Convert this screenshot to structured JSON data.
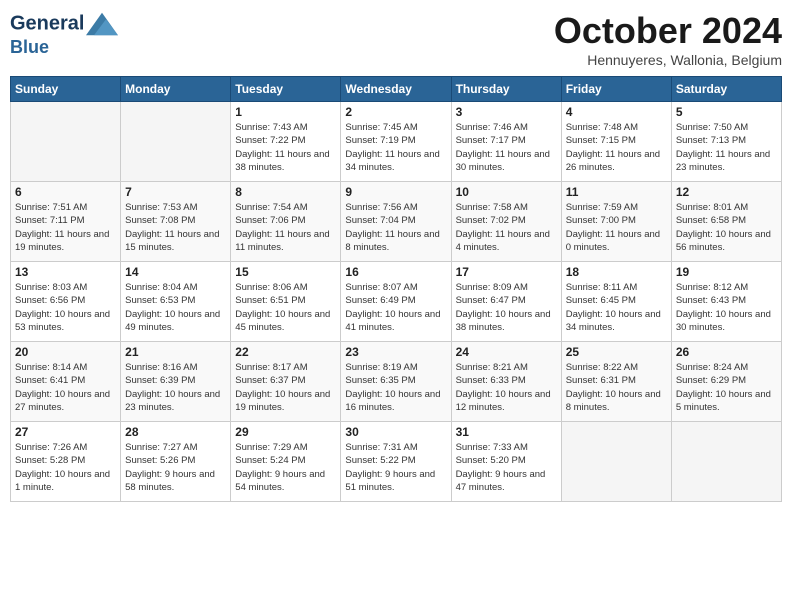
{
  "header": {
    "logo_line1": "General",
    "logo_line2": "Blue",
    "month_title": "October 2024",
    "location": "Hennuyeres, Wallonia, Belgium"
  },
  "days_of_week": [
    "Sunday",
    "Monday",
    "Tuesday",
    "Wednesday",
    "Thursday",
    "Friday",
    "Saturday"
  ],
  "weeks": [
    [
      {
        "day": "",
        "empty": true
      },
      {
        "day": "",
        "empty": true
      },
      {
        "day": "1",
        "sunrise": "7:43 AM",
        "sunset": "7:22 PM",
        "daylight": "11 hours and 38 minutes."
      },
      {
        "day": "2",
        "sunrise": "7:45 AM",
        "sunset": "7:19 PM",
        "daylight": "11 hours and 34 minutes."
      },
      {
        "day": "3",
        "sunrise": "7:46 AM",
        "sunset": "7:17 PM",
        "daylight": "11 hours and 30 minutes."
      },
      {
        "day": "4",
        "sunrise": "7:48 AM",
        "sunset": "7:15 PM",
        "daylight": "11 hours and 26 minutes."
      },
      {
        "day": "5",
        "sunrise": "7:50 AM",
        "sunset": "7:13 PM",
        "daylight": "11 hours and 23 minutes."
      }
    ],
    [
      {
        "day": "6",
        "sunrise": "7:51 AM",
        "sunset": "7:11 PM",
        "daylight": "11 hours and 19 minutes."
      },
      {
        "day": "7",
        "sunrise": "7:53 AM",
        "sunset": "7:08 PM",
        "daylight": "11 hours and 15 minutes."
      },
      {
        "day": "8",
        "sunrise": "7:54 AM",
        "sunset": "7:06 PM",
        "daylight": "11 hours and 11 minutes."
      },
      {
        "day": "9",
        "sunrise": "7:56 AM",
        "sunset": "7:04 PM",
        "daylight": "11 hours and 8 minutes."
      },
      {
        "day": "10",
        "sunrise": "7:58 AM",
        "sunset": "7:02 PM",
        "daylight": "11 hours and 4 minutes."
      },
      {
        "day": "11",
        "sunrise": "7:59 AM",
        "sunset": "7:00 PM",
        "daylight": "11 hours and 0 minutes."
      },
      {
        "day": "12",
        "sunrise": "8:01 AM",
        "sunset": "6:58 PM",
        "daylight": "10 hours and 56 minutes."
      }
    ],
    [
      {
        "day": "13",
        "sunrise": "8:03 AM",
        "sunset": "6:56 PM",
        "daylight": "10 hours and 53 minutes."
      },
      {
        "day": "14",
        "sunrise": "8:04 AM",
        "sunset": "6:53 PM",
        "daylight": "10 hours and 49 minutes."
      },
      {
        "day": "15",
        "sunrise": "8:06 AM",
        "sunset": "6:51 PM",
        "daylight": "10 hours and 45 minutes."
      },
      {
        "day": "16",
        "sunrise": "8:07 AM",
        "sunset": "6:49 PM",
        "daylight": "10 hours and 41 minutes."
      },
      {
        "day": "17",
        "sunrise": "8:09 AM",
        "sunset": "6:47 PM",
        "daylight": "10 hours and 38 minutes."
      },
      {
        "day": "18",
        "sunrise": "8:11 AM",
        "sunset": "6:45 PM",
        "daylight": "10 hours and 34 minutes."
      },
      {
        "day": "19",
        "sunrise": "8:12 AM",
        "sunset": "6:43 PM",
        "daylight": "10 hours and 30 minutes."
      }
    ],
    [
      {
        "day": "20",
        "sunrise": "8:14 AM",
        "sunset": "6:41 PM",
        "daylight": "10 hours and 27 minutes."
      },
      {
        "day": "21",
        "sunrise": "8:16 AM",
        "sunset": "6:39 PM",
        "daylight": "10 hours and 23 minutes."
      },
      {
        "day": "22",
        "sunrise": "8:17 AM",
        "sunset": "6:37 PM",
        "daylight": "10 hours and 19 minutes."
      },
      {
        "day": "23",
        "sunrise": "8:19 AM",
        "sunset": "6:35 PM",
        "daylight": "10 hours and 16 minutes."
      },
      {
        "day": "24",
        "sunrise": "8:21 AM",
        "sunset": "6:33 PM",
        "daylight": "10 hours and 12 minutes."
      },
      {
        "day": "25",
        "sunrise": "8:22 AM",
        "sunset": "6:31 PM",
        "daylight": "10 hours and 8 minutes."
      },
      {
        "day": "26",
        "sunrise": "8:24 AM",
        "sunset": "6:29 PM",
        "daylight": "10 hours and 5 minutes."
      }
    ],
    [
      {
        "day": "27",
        "sunrise": "7:26 AM",
        "sunset": "5:28 PM",
        "daylight": "10 hours and 1 minute."
      },
      {
        "day": "28",
        "sunrise": "7:27 AM",
        "sunset": "5:26 PM",
        "daylight": "9 hours and 58 minutes."
      },
      {
        "day": "29",
        "sunrise": "7:29 AM",
        "sunset": "5:24 PM",
        "daylight": "9 hours and 54 minutes."
      },
      {
        "day": "30",
        "sunrise": "7:31 AM",
        "sunset": "5:22 PM",
        "daylight": "9 hours and 51 minutes."
      },
      {
        "day": "31",
        "sunrise": "7:33 AM",
        "sunset": "5:20 PM",
        "daylight": "9 hours and 47 minutes."
      },
      {
        "day": "",
        "empty": true
      },
      {
        "day": "",
        "empty": true
      }
    ]
  ],
  "labels": {
    "sunrise": "Sunrise:",
    "sunset": "Sunset:",
    "daylight": "Daylight:"
  }
}
